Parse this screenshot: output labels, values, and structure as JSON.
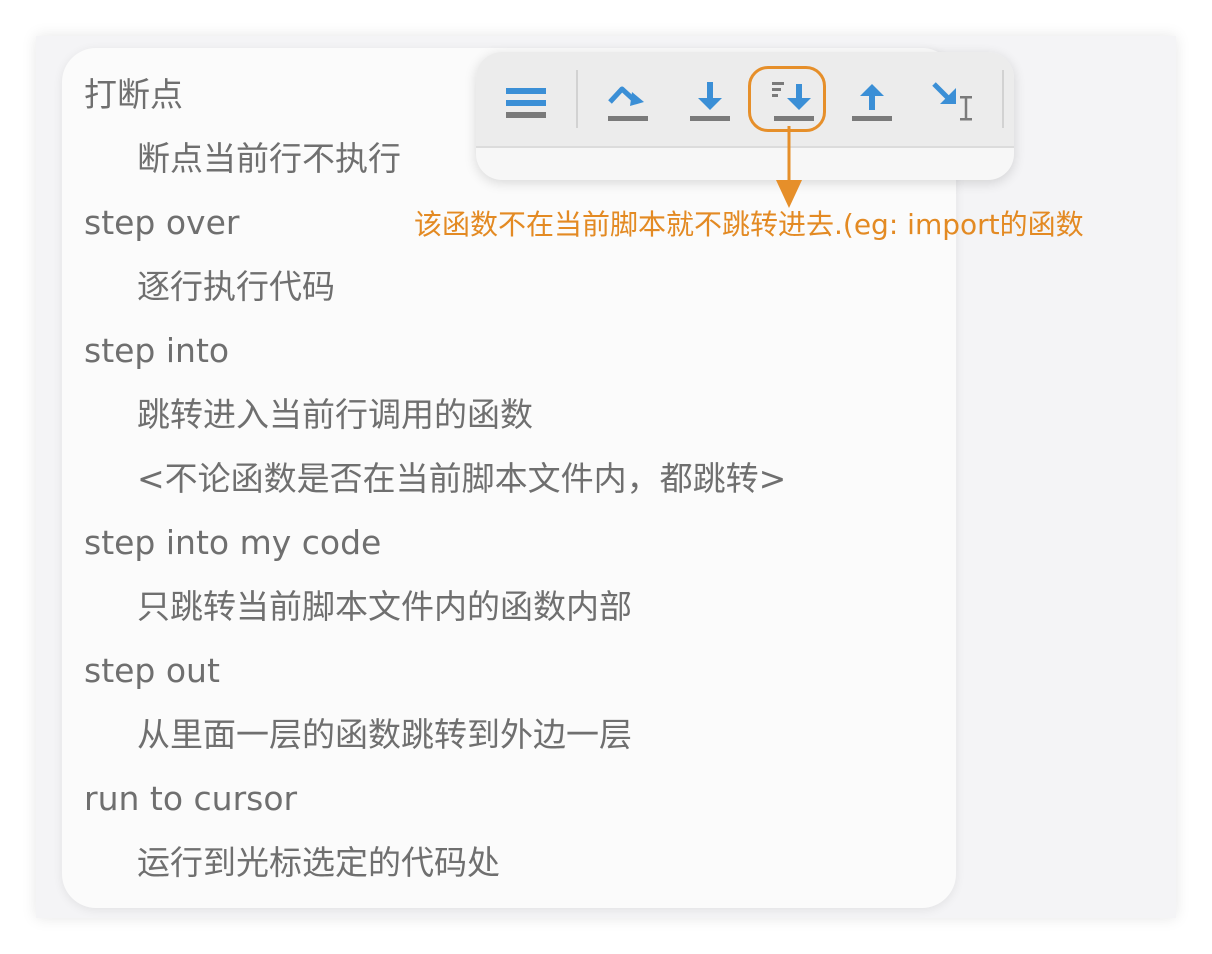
{
  "colors": {
    "text": "#6f6f6f",
    "annotation": "#e38a23",
    "icon_blue": "#3b8fd6",
    "icon_gray": "#7a7a7a"
  },
  "toolbar": {
    "buttons": [
      {
        "icon": "menu-lines-icon"
      },
      {
        "icon": "step-over-icon"
      },
      {
        "icon": "step-into-icon"
      },
      {
        "icon": "step-into-my-code-icon"
      },
      {
        "icon": "step-out-icon"
      },
      {
        "icon": "run-to-cursor-icon"
      }
    ]
  },
  "annotation": {
    "text": "该函数不在当前脚本就不跳转进去.(eg: import的函数"
  },
  "notes": [
    {
      "title": "打断点",
      "desc": [
        "断点当前行不执行"
      ]
    },
    {
      "title": "step over",
      "desc": [
        "逐行执行代码"
      ]
    },
    {
      "title": "step into",
      "desc": [
        "跳转进入当前行调用的函数",
        "<不论函数是否在当前脚本文件内，都跳转>"
      ]
    },
    {
      "title": "step into my code",
      "desc": [
        "只跳转当前脚本文件内的函数内部"
      ]
    },
    {
      "title": "step out",
      "desc": [
        "从里面一层的函数跳转到外边一层"
      ]
    },
    {
      "title": "run to cursor",
      "desc": [
        "运行到光标选定的代码处"
      ]
    }
  ]
}
